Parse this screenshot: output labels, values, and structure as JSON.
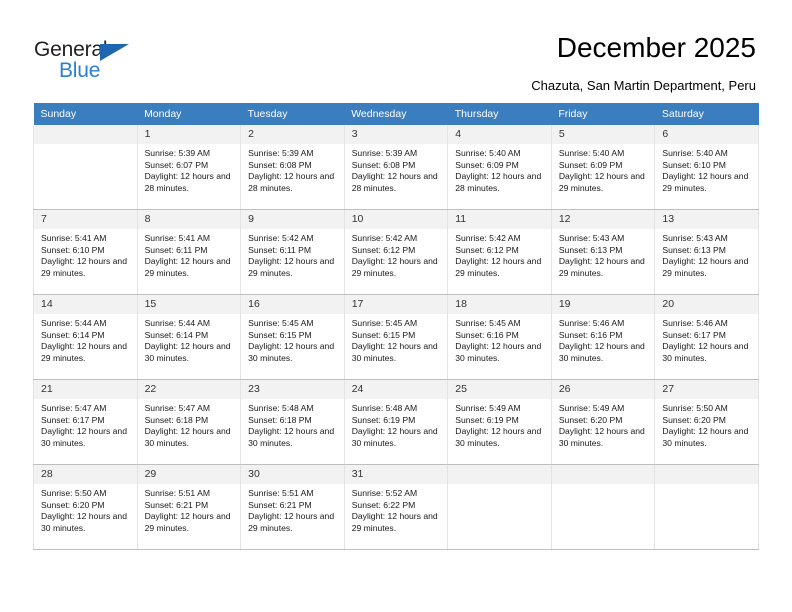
{
  "logo": {
    "word_one": "General",
    "word_two": "Blue",
    "triangle_color": "#1f66b0",
    "blue_color": "#2a7fd4"
  },
  "header": {
    "title": "December 2025",
    "subtitle": "Chazuta, San Martin Department, Peru"
  },
  "calendar": {
    "header_bg": "#3a7ebf",
    "daynum_bg": "#f2f2f2",
    "weekdays": [
      "Sunday",
      "Monday",
      "Tuesday",
      "Wednesday",
      "Thursday",
      "Friday",
      "Saturday"
    ],
    "weeks": [
      [
        {
          "day": "",
          "sunrise": "",
          "sunset": "",
          "daylight": "",
          "empty": true
        },
        {
          "day": "1",
          "sunrise": "Sunrise: 5:39 AM",
          "sunset": "Sunset: 6:07 PM",
          "daylight": "Daylight: 12 hours and 28 minutes."
        },
        {
          "day": "2",
          "sunrise": "Sunrise: 5:39 AM",
          "sunset": "Sunset: 6:08 PM",
          "daylight": "Daylight: 12 hours and 28 minutes."
        },
        {
          "day": "3",
          "sunrise": "Sunrise: 5:39 AM",
          "sunset": "Sunset: 6:08 PM",
          "daylight": "Daylight: 12 hours and 28 minutes."
        },
        {
          "day": "4",
          "sunrise": "Sunrise: 5:40 AM",
          "sunset": "Sunset: 6:09 PM",
          "daylight": "Daylight: 12 hours and 28 minutes."
        },
        {
          "day": "5",
          "sunrise": "Sunrise: 5:40 AM",
          "sunset": "Sunset: 6:09 PM",
          "daylight": "Daylight: 12 hours and 29 minutes."
        },
        {
          "day": "6",
          "sunrise": "Sunrise: 5:40 AM",
          "sunset": "Sunset: 6:10 PM",
          "daylight": "Daylight: 12 hours and 29 minutes."
        }
      ],
      [
        {
          "day": "7",
          "sunrise": "Sunrise: 5:41 AM",
          "sunset": "Sunset: 6:10 PM",
          "daylight": "Daylight: 12 hours and 29 minutes."
        },
        {
          "day": "8",
          "sunrise": "Sunrise: 5:41 AM",
          "sunset": "Sunset: 6:11 PM",
          "daylight": "Daylight: 12 hours and 29 minutes."
        },
        {
          "day": "9",
          "sunrise": "Sunrise: 5:42 AM",
          "sunset": "Sunset: 6:11 PM",
          "daylight": "Daylight: 12 hours and 29 minutes."
        },
        {
          "day": "10",
          "sunrise": "Sunrise: 5:42 AM",
          "sunset": "Sunset: 6:12 PM",
          "daylight": "Daylight: 12 hours and 29 minutes."
        },
        {
          "day": "11",
          "sunrise": "Sunrise: 5:42 AM",
          "sunset": "Sunset: 6:12 PM",
          "daylight": "Daylight: 12 hours and 29 minutes."
        },
        {
          "day": "12",
          "sunrise": "Sunrise: 5:43 AM",
          "sunset": "Sunset: 6:13 PM",
          "daylight": "Daylight: 12 hours and 29 minutes."
        },
        {
          "day": "13",
          "sunrise": "Sunrise: 5:43 AM",
          "sunset": "Sunset: 6:13 PM",
          "daylight": "Daylight: 12 hours and 29 minutes."
        }
      ],
      [
        {
          "day": "14",
          "sunrise": "Sunrise: 5:44 AM",
          "sunset": "Sunset: 6:14 PM",
          "daylight": "Daylight: 12 hours and 29 minutes."
        },
        {
          "day": "15",
          "sunrise": "Sunrise: 5:44 AM",
          "sunset": "Sunset: 6:14 PM",
          "daylight": "Daylight: 12 hours and 30 minutes."
        },
        {
          "day": "16",
          "sunrise": "Sunrise: 5:45 AM",
          "sunset": "Sunset: 6:15 PM",
          "daylight": "Daylight: 12 hours and 30 minutes."
        },
        {
          "day": "17",
          "sunrise": "Sunrise: 5:45 AM",
          "sunset": "Sunset: 6:15 PM",
          "daylight": "Daylight: 12 hours and 30 minutes."
        },
        {
          "day": "18",
          "sunrise": "Sunrise: 5:45 AM",
          "sunset": "Sunset: 6:16 PM",
          "daylight": "Daylight: 12 hours and 30 minutes."
        },
        {
          "day": "19",
          "sunrise": "Sunrise: 5:46 AM",
          "sunset": "Sunset: 6:16 PM",
          "daylight": "Daylight: 12 hours and 30 minutes."
        },
        {
          "day": "20",
          "sunrise": "Sunrise: 5:46 AM",
          "sunset": "Sunset: 6:17 PM",
          "daylight": "Daylight: 12 hours and 30 minutes."
        }
      ],
      [
        {
          "day": "21",
          "sunrise": "Sunrise: 5:47 AM",
          "sunset": "Sunset: 6:17 PM",
          "daylight": "Daylight: 12 hours and 30 minutes."
        },
        {
          "day": "22",
          "sunrise": "Sunrise: 5:47 AM",
          "sunset": "Sunset: 6:18 PM",
          "daylight": "Daylight: 12 hours and 30 minutes."
        },
        {
          "day": "23",
          "sunrise": "Sunrise: 5:48 AM",
          "sunset": "Sunset: 6:18 PM",
          "daylight": "Daylight: 12 hours and 30 minutes."
        },
        {
          "day": "24",
          "sunrise": "Sunrise: 5:48 AM",
          "sunset": "Sunset: 6:19 PM",
          "daylight": "Daylight: 12 hours and 30 minutes."
        },
        {
          "day": "25",
          "sunrise": "Sunrise: 5:49 AM",
          "sunset": "Sunset: 6:19 PM",
          "daylight": "Daylight: 12 hours and 30 minutes."
        },
        {
          "day": "26",
          "sunrise": "Sunrise: 5:49 AM",
          "sunset": "Sunset: 6:20 PM",
          "daylight": "Daylight: 12 hours and 30 minutes."
        },
        {
          "day": "27",
          "sunrise": "Sunrise: 5:50 AM",
          "sunset": "Sunset: 6:20 PM",
          "daylight": "Daylight: 12 hours and 30 minutes."
        }
      ],
      [
        {
          "day": "28",
          "sunrise": "Sunrise: 5:50 AM",
          "sunset": "Sunset: 6:20 PM",
          "daylight": "Daylight: 12 hours and 30 minutes."
        },
        {
          "day": "29",
          "sunrise": "Sunrise: 5:51 AM",
          "sunset": "Sunset: 6:21 PM",
          "daylight": "Daylight: 12 hours and 29 minutes."
        },
        {
          "day": "30",
          "sunrise": "Sunrise: 5:51 AM",
          "sunset": "Sunset: 6:21 PM",
          "daylight": "Daylight: 12 hours and 29 minutes."
        },
        {
          "day": "31",
          "sunrise": "Sunrise: 5:52 AM",
          "sunset": "Sunset: 6:22 PM",
          "daylight": "Daylight: 12 hours and 29 minutes."
        },
        {
          "day": "",
          "sunrise": "",
          "sunset": "",
          "daylight": "",
          "empty": true
        },
        {
          "day": "",
          "sunrise": "",
          "sunset": "",
          "daylight": "",
          "empty": true
        },
        {
          "day": "",
          "sunrise": "",
          "sunset": "",
          "daylight": "",
          "empty": true
        }
      ]
    ]
  }
}
